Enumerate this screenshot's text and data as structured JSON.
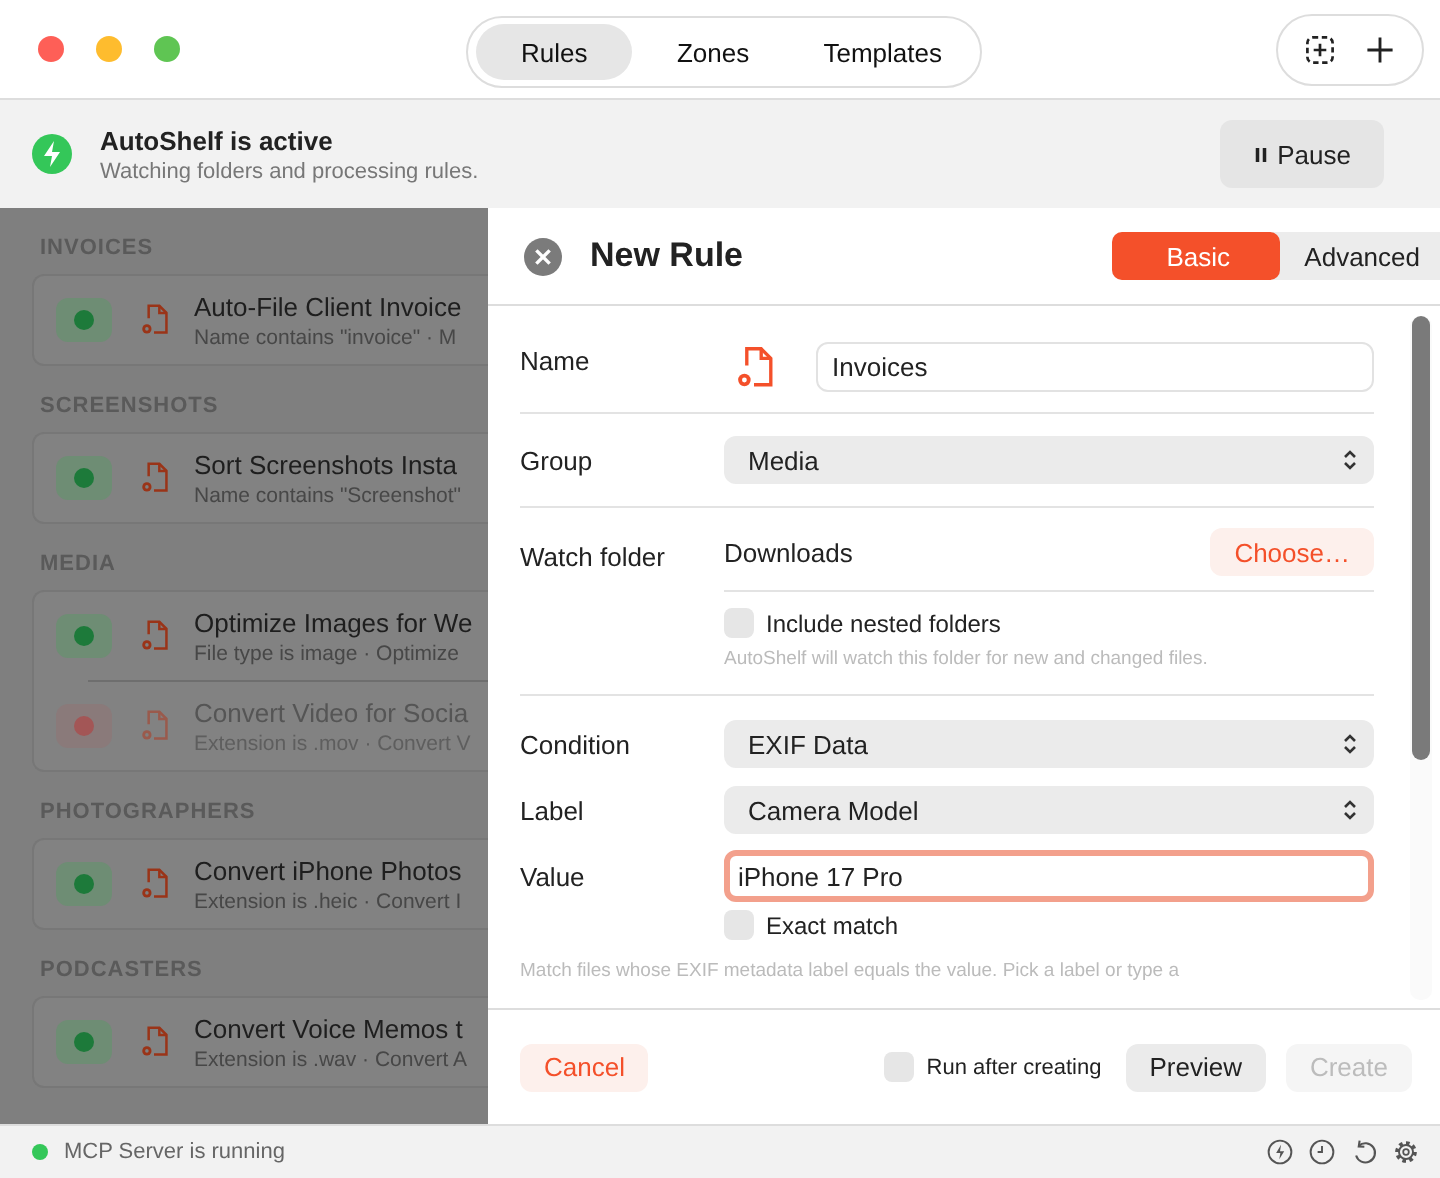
{
  "window": {
    "tabs": [
      {
        "label": "Rules",
        "selected": true
      },
      {
        "label": "Zones",
        "selected": false
      },
      {
        "label": "Templates",
        "selected": false
      }
    ]
  },
  "banner": {
    "title": "AutoShelf is active",
    "subtitle": "Watching folders and processing rules.",
    "button": "Pause"
  },
  "rule_groups": [
    {
      "heading": "INVOICES",
      "rules": [
        {
          "title": "Auto-File Client Invoice",
          "summary": "Name contains \"invoice\" · M",
          "enabled": true
        }
      ]
    },
    {
      "heading": "SCREENSHOTS",
      "rules": [
        {
          "title": "Sort Screenshots Insta",
          "summary": "Name contains \"Screenshot\"",
          "enabled": true
        }
      ]
    },
    {
      "heading": "MEDIA",
      "rules": [
        {
          "title": "Optimize Images for We",
          "summary": "File type is image · Optimize",
          "enabled": true
        },
        {
          "title": "Convert Video for Socia",
          "summary": "Extension is .mov · Convert V",
          "enabled": false
        }
      ]
    },
    {
      "heading": "PHOTOGRAPHERS",
      "rules": [
        {
          "title": "Convert iPhone Photos",
          "summary": "Extension is .heic · Convert I",
          "enabled": true
        }
      ]
    },
    {
      "heading": "PODCASTERS",
      "rules": [
        {
          "title": "Convert Voice Memos t",
          "summary": "Extension is .wav · Convert A",
          "enabled": true
        }
      ]
    }
  ],
  "sheet": {
    "title": "New Rule",
    "modes": [
      {
        "label": "Basic",
        "selected": true
      },
      {
        "label": "Advanced",
        "selected": false
      }
    ],
    "name": {
      "label": "Name",
      "value": "Invoices"
    },
    "group": {
      "label": "Group",
      "value": "Media"
    },
    "watch_folder": {
      "label": "Watch folder",
      "value": "Downloads",
      "button": "Choose…",
      "include_nested": {
        "label": "Include nested folders",
        "checked": false
      },
      "hint": "AutoShelf will watch this folder for new and changed files."
    },
    "condition": {
      "label": "Condition",
      "value": "EXIF Data"
    },
    "exif_label": {
      "label": "Label",
      "value": "Camera Model"
    },
    "match_value": {
      "label": "Value",
      "value": "iPhone 17 Pro",
      "focused": true
    },
    "exact_match": {
      "label": "Exact match",
      "checked": false
    },
    "hint": "Match files whose EXIF metadata label equals the value. Pick a label or type a"
  },
  "footer": {
    "cancel": "Cancel",
    "run_after": {
      "label": "Run after creating",
      "checked": false
    },
    "preview": "Preview",
    "create": {
      "label": "Create",
      "disabled": true
    }
  },
  "status_bar": {
    "text": "MCP Server is running",
    "running": true
  }
}
